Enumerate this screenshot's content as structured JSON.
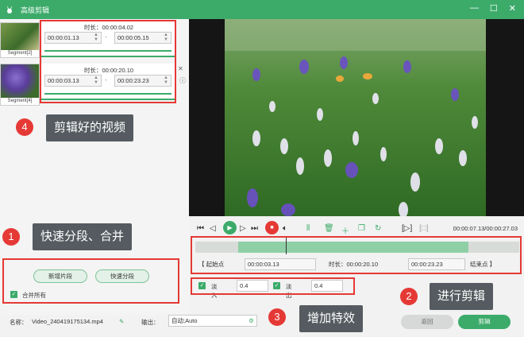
{
  "window": {
    "title": "高级剪辑",
    "minimize": "—",
    "maximize": "☐",
    "close": "✕",
    "icon": "rabbit-app-icon"
  },
  "segments": [
    {
      "caption": "Segment[2]",
      "duration_label": "时长：",
      "duration": "00:00:04.02",
      "start": "00:00:01.13",
      "end": "00:00:05.15"
    },
    {
      "caption": "Segment[4]",
      "duration_label": "时长：",
      "duration": "00:00:20.10",
      "start": "00:00:03.13",
      "end": "00:00:23.23"
    }
  ],
  "annotations": {
    "a1": {
      "number": "1",
      "text": "快速分段、合并"
    },
    "a2": {
      "number": "2",
      "text": "进行剪辑"
    },
    "a3": {
      "number": "3",
      "text": "增加特效"
    },
    "a4": {
      "number": "4",
      "text": "剪辑好的视频"
    }
  },
  "left_actions": {
    "new_segment": "新增片段",
    "quick_split": "快速分段",
    "merge_all": "合并所有"
  },
  "player": {
    "timecode": "00:00:07.13/00:00:27.03"
  },
  "trim": {
    "start_label": "起始点",
    "start_value": "00:00:03.13",
    "duration_label": "时长：",
    "duration_value": "00:00:20.10",
    "end_value": "00:00:23.23",
    "end_label": "结束点"
  },
  "effects": {
    "fade_in_label": "淡入",
    "fade_in_value": "0.4",
    "fade_out_label": "淡出",
    "fade_out_value": "0.4"
  },
  "footer": {
    "name_label": "名称：",
    "name_value": "Video_240419175134.mp4",
    "output_label": "输出：",
    "output_value": "自动;Auto",
    "back_button": "返回",
    "cut_button": "剪辑"
  },
  "colors": {
    "accent": "#3cab6a",
    "annotation_red": "#e53935",
    "annotation_bg": "#555b60"
  }
}
